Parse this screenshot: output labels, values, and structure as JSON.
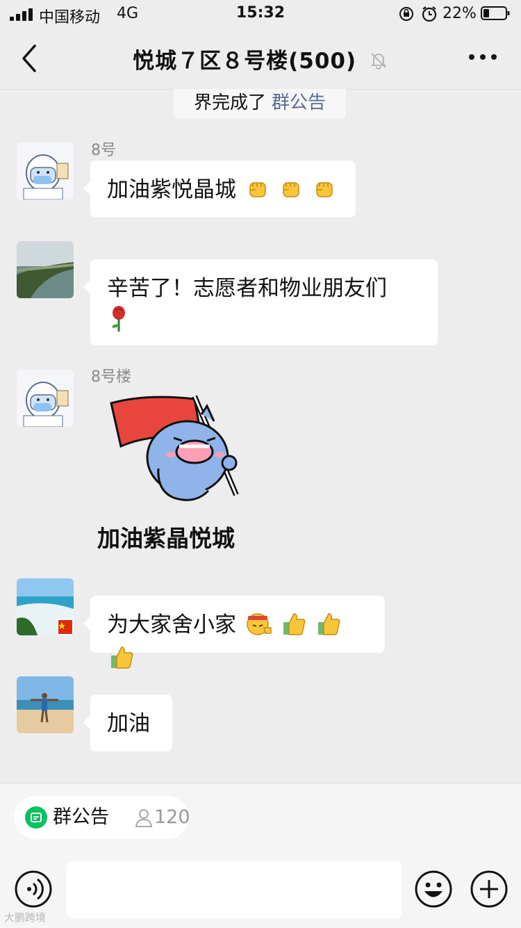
{
  "status_bar": {
    "carrier": "中国移动",
    "network": "4G",
    "time": "15:32",
    "battery": "22%"
  },
  "nav": {
    "title": "悦城７区８号楼(500)"
  },
  "pinned_notice": {
    "text": "界完成了",
    "link": "群公告"
  },
  "messages": [
    {
      "sender": "8号",
      "text": "加油紫悦晶城",
      "emoji": [
        "fist-icon",
        "fist-icon",
        "fist-icon"
      ]
    },
    {
      "sender": "",
      "text": "辛苦了！志愿者和物业朋友们",
      "emoji": [
        "rose-icon"
      ]
    },
    {
      "sender": "8号楼",
      "sticker_caption": "加油紫晶悦城"
    },
    {
      "sender": "",
      "text": "为大家舍小家",
      "emoji": [
        "salute-face-icon",
        "thumbs-up-icon",
        "thumbs-up-icon",
        "thumbs-up-icon"
      ]
    },
    {
      "sender": "",
      "text": "加油"
    }
  ],
  "bottom": {
    "notice_label": "群公告",
    "member_count": "120"
  },
  "watermark": "大鹏跨境",
  "colors": {
    "background": "#ededed",
    "bubble": "#ffffff",
    "link": "#576b95",
    "wechat_green": "#07c160",
    "sticker_flag": "#e8453c",
    "sticker_shark": "#8fb4ea"
  }
}
